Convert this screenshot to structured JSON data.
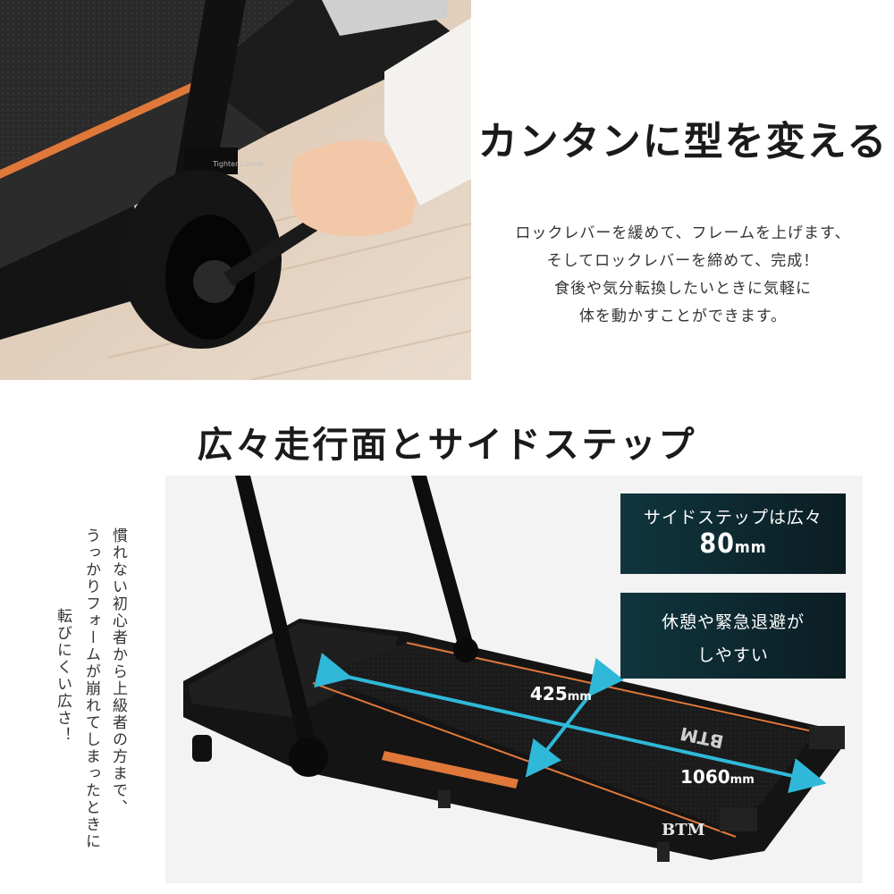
{
  "top": {
    "heading": "カンタンに型を変える",
    "desc_lines": [
      "ロックレバーを緩めて、フレームを上げます、",
      "そしてロックレバーを締めて、完成！",
      "食後や気分転換したいときに気軽に",
      "体を動かすことができます。"
    ],
    "frame_label": "Tighter  Looser"
  },
  "middle": {
    "heading": "広々走行面とサイドステップ"
  },
  "side_text": {
    "col1": "慣れない初心者から上級者の方まで、",
    "col2": "うっかりフォームが崩れてしまったときに",
    "col3": "転びにくい広さ！"
  },
  "callouts": {
    "c1_line1": "サイドステップは広々",
    "c1_num": "80",
    "c1_unit": "mm",
    "c2_line1": "休憩や緊急退避が",
    "c2_line2": "しやすい"
  },
  "dimensions": {
    "width_num": "425",
    "width_unit": "mm",
    "length_num": "1060",
    "length_unit": "mm"
  },
  "brand": {
    "logo": "BTM",
    "logo_mirrored": "BTM"
  },
  "colors": {
    "accent_orange": "#e0783a",
    "arrow_cyan": "#2fb8d8",
    "callout_bg": "#0f2e36"
  }
}
